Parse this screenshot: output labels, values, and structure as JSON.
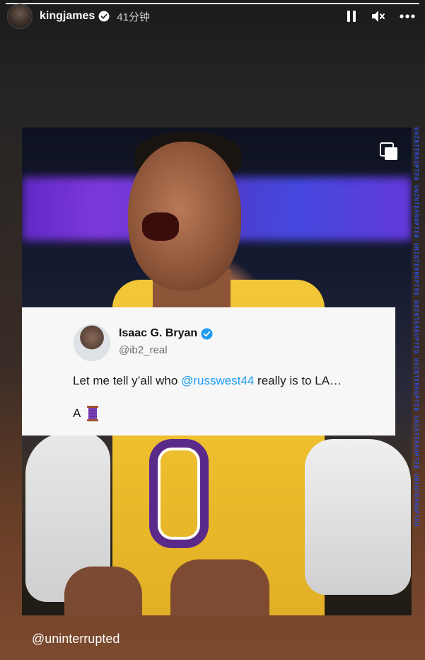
{
  "header": {
    "username": "kingjames",
    "time": "41分钟",
    "verified": true
  },
  "icons": {
    "pause": "pause-icon",
    "mute": "mute-icon",
    "more": "more-icon",
    "copy": "copy-icon"
  },
  "tweet": {
    "name": "Isaac G. Bryan",
    "handle": "@ib2_real",
    "text_before": "Let me tell y’all who ",
    "mention": "@russwest44",
    "text_after": " really is to LA…",
    "line2": "A"
  },
  "watermark": "UNINTERRUPTED UNINTERRUPTED UNINTERRUPTED UNINTERRUPTED UNINTERRUPTED UNINTERRUPTED UNINTERRUPTED",
  "caption": "@uninterrupted",
  "colors": {
    "mention": "#1d9bf0",
    "watermark": "#2e4fe0",
    "jersey": "#f1c738",
    "purple": "#5a2a8a"
  }
}
